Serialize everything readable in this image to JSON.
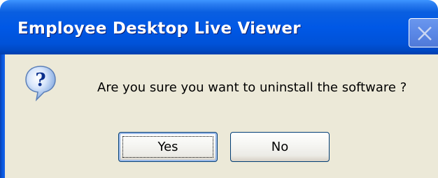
{
  "window": {
    "title": "Employee Desktop Live Viewer",
    "close_icon": "close-icon"
  },
  "dialog": {
    "icon": "question-icon",
    "message": "Are you sure you want to uninstall the software ?",
    "buttons": {
      "yes_label": "Yes",
      "no_label": "No"
    },
    "default_button": "Yes"
  },
  "colors": {
    "titlebar": "#0058e6",
    "body": "#ece9d8",
    "button_border": "#003c74"
  }
}
